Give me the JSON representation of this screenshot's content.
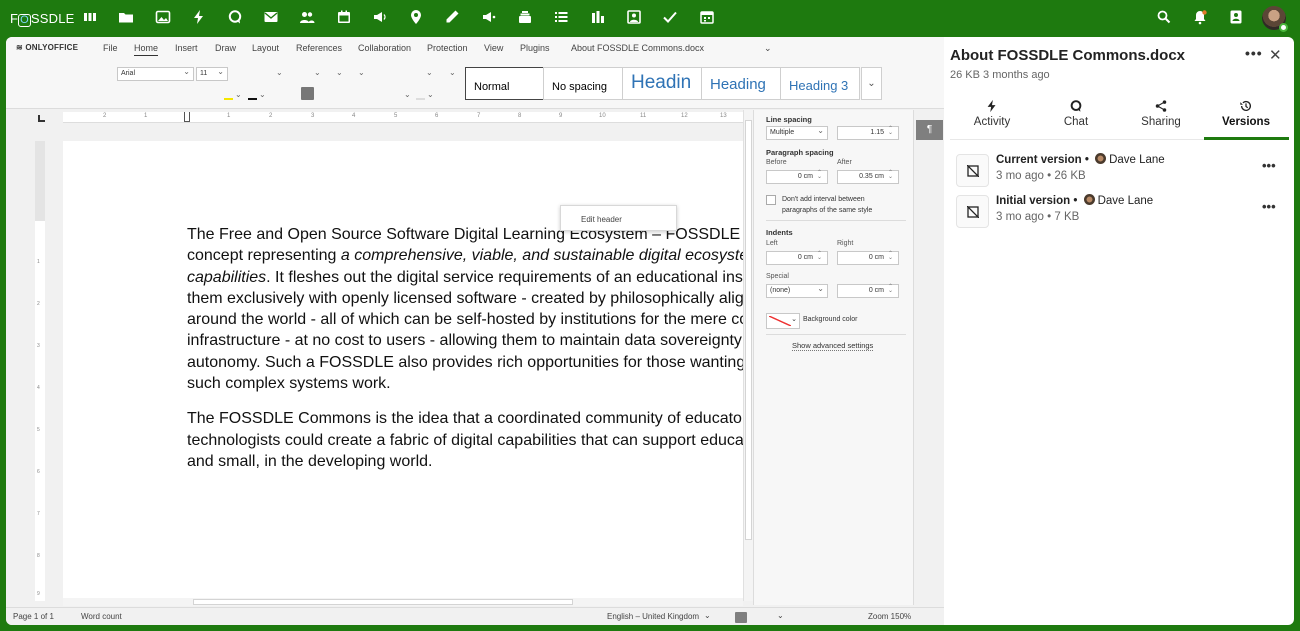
{
  "topbar": {
    "logo_prefix": "F",
    "logo_o": "O",
    "logo_suffix": "SSDLE",
    "app_icons": [
      "dashboard-icon",
      "files-icon",
      "photos-icon",
      "activity-icon",
      "talk-icon",
      "mail-icon",
      "contacts-icon",
      "calendar-icon",
      "announcements-icon",
      "maps-icon",
      "notes-icon",
      "forms-icon",
      "deck-icon",
      "tasks-icon",
      "analytics-icon",
      "whiteboard-icon",
      "polls-icon",
      "calendar2-icon"
    ],
    "right_icons": [
      "search-icon",
      "notifications-icon",
      "contacts-menu-icon",
      "user-avatar"
    ],
    "accent_color": "#1e7a0f",
    "notification_color": "#e07a2a"
  },
  "editor": {
    "brand": "ONLYOFFICE",
    "menu": [
      "File",
      "Home",
      "Insert",
      "Draw",
      "Layout",
      "References",
      "Collaboration",
      "Protection",
      "View",
      "Plugins"
    ],
    "active_menu": "Home",
    "doc_title": "About FOSSDLE Commons.docx",
    "font_name": "Arial",
    "font_size": "11",
    "styles": [
      "Normal",
      "No spacing",
      "Headin",
      "Heading",
      "Heading 3"
    ],
    "ruler_ticks": [
      "2",
      "1",
      "1",
      "2",
      "3",
      "4",
      "5",
      "6",
      "7",
      "8",
      "9",
      "10",
      "11",
      "12",
      "13"
    ],
    "vruler_ticks": [
      "1",
      "2",
      "3",
      "4",
      "5",
      "6",
      "7",
      "8",
      "9"
    ],
    "context_menu_item": "Edit header",
    "paragraph1_a": "The Free and Open Source Software Digital Learning Ecosystem – FOSSDLE\nconcept representing ",
    "paragraph1_italic": "a comprehensive, viable, and sustainable digital ecosyste\ncapabilities",
    "paragraph1_b": ". It fleshes out the digital service requirements of an educational inst\nthem exclusively with openly licensed software - created by philosophically alig\naround the world - all of which can be self-hosted by institutions for the mere co\ninfrastructure - at no cost to users - allowing them to maintain data sovereignty\nautonomy. Such a FOSSDLE also provides rich opportunities for those wanting\nsuch complex systems work.",
    "paragraph2": "The FOSSDLE Commons is the idea that a coordinated community of educator\ntechnologists could create a fabric of digital capabilities that can support educa\nand small, in the developing world.",
    "right_panel": {
      "line_spacing_label": "Line spacing",
      "line_spacing_mode": "Multiple",
      "line_spacing_value": "1.15",
      "paragraph_spacing_label": "Paragraph spacing",
      "before_label": "Before",
      "after_label": "After",
      "before_value": "0 cm",
      "after_value": "0.35 cm",
      "dont_add_interval": "Don't add interval between\nparagraphs of the same style",
      "indents_label": "Indents",
      "left_label": "Left",
      "right_label": "Right",
      "left_value": "0 cm",
      "right_value": "0 cm",
      "special_label": "Special",
      "special_value": "(none)",
      "special_amount": "0 cm",
      "background_color": "Background color",
      "show_advanced": "Show advanced settings"
    },
    "status": {
      "page": "Page 1 of 1",
      "word_count": "Word count",
      "language": "English – United Kingdom",
      "zoom": "Zoom 150%"
    }
  },
  "sidebar": {
    "title": "About FOSSDLE Commons.docx",
    "subtitle": "26 KB 3 months ago",
    "more": "•••",
    "close": "✕",
    "tabs": [
      {
        "label": "Activity",
        "icon": "activity-icon"
      },
      {
        "label": "Chat",
        "icon": "chat-icon"
      },
      {
        "label": "Sharing",
        "icon": "share-icon"
      },
      {
        "label": "Versions",
        "icon": "history-icon"
      }
    ],
    "active_tab": "Versions",
    "versions": [
      {
        "title": "Current version",
        "sep": "•",
        "author": "Dave Lane",
        "meta": "3 mo ago  •  26 KB",
        "menu": "•••"
      },
      {
        "title": "Initial version",
        "sep": "•",
        "author": "Dave Lane",
        "meta": "3 mo ago  •  7 KB",
        "menu": "•••"
      }
    ]
  }
}
